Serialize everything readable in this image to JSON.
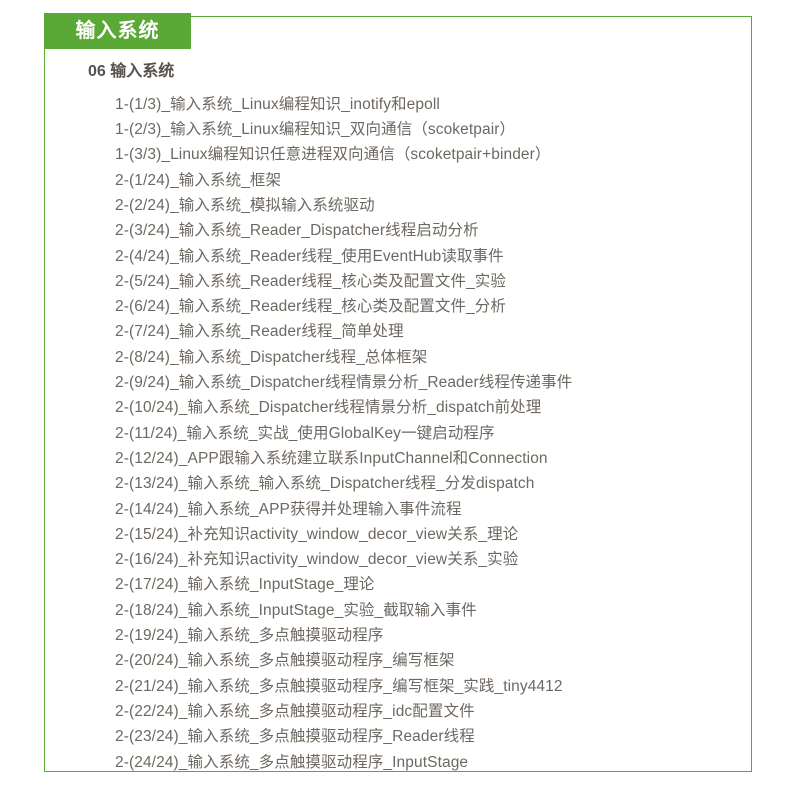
{
  "tag": {
    "label": "输入系统",
    "background_color": "#5aa835",
    "text_color": "#ffffff"
  },
  "frame": {
    "border_color": "#5aa835"
  },
  "heading": "06 输入系统",
  "lessons": [
    "1-(1/3)_输入系统_Linux编程知识_inotify和epoll",
    "1-(2/3)_输入系统_Linux编程知识_双向通信（scoketpair）",
    "1-(3/3)_Linux编程知识任意进程双向通信（scoketpair+binder）",
    "2-(1/24)_输入系统_框架",
    "2-(2/24)_输入系统_模拟输入系统驱动",
    "2-(3/24)_输入系统_Reader_Dispatcher线程启动分析",
    "2-(4/24)_输入系统_Reader线程_使用EventHub读取事件",
    "2-(5/24)_输入系统_Reader线程_核心类及配置文件_实验",
    "2-(6/24)_输入系统_Reader线程_核心类及配置文件_分析",
    "2-(7/24)_输入系统_Reader线程_简单处理",
    "2-(8/24)_输入系统_Dispatcher线程_总体框架",
    "2-(9/24)_输入系统_Dispatcher线程情景分析_Reader线程传递事件",
    "2-(10/24)_输入系统_Dispatcher线程情景分析_dispatch前处理",
    "2-(11/24)_输入系统_实战_使用GlobalKey一键启动程序",
    "2-(12/24)_APP跟输入系统建立联系InputChannel和Connection",
    "2-(13/24)_输入系统_输入系统_Dispatcher线程_分发dispatch",
    "2-(14/24)_输入系统_APP获得并处理输入事件流程",
    "2-(15/24)_补充知识activity_window_decor_view关系_理论",
    "2-(16/24)_补充知识activity_window_decor_view关系_实验",
    "2-(17/24)_输入系统_InputStage_理论",
    "2-(18/24)_输入系统_InputStage_实验_截取输入事件",
    "2-(19/24)_输入系统_多点触摸驱动程序",
    "2-(20/24)_输入系统_多点触摸驱动程序_编写框架",
    "2-(21/24)_输入系统_多点触摸驱动程序_编写框架_实践_tiny4412",
    "2-(22/24)_输入系统_多点触摸驱动程序_idc配置文件",
    "2-(23/24)_输入系统_多点触摸驱动程序_Reader线程",
    "2-(24/24)_输入系统_多点触摸驱动程序_InputStage"
  ]
}
